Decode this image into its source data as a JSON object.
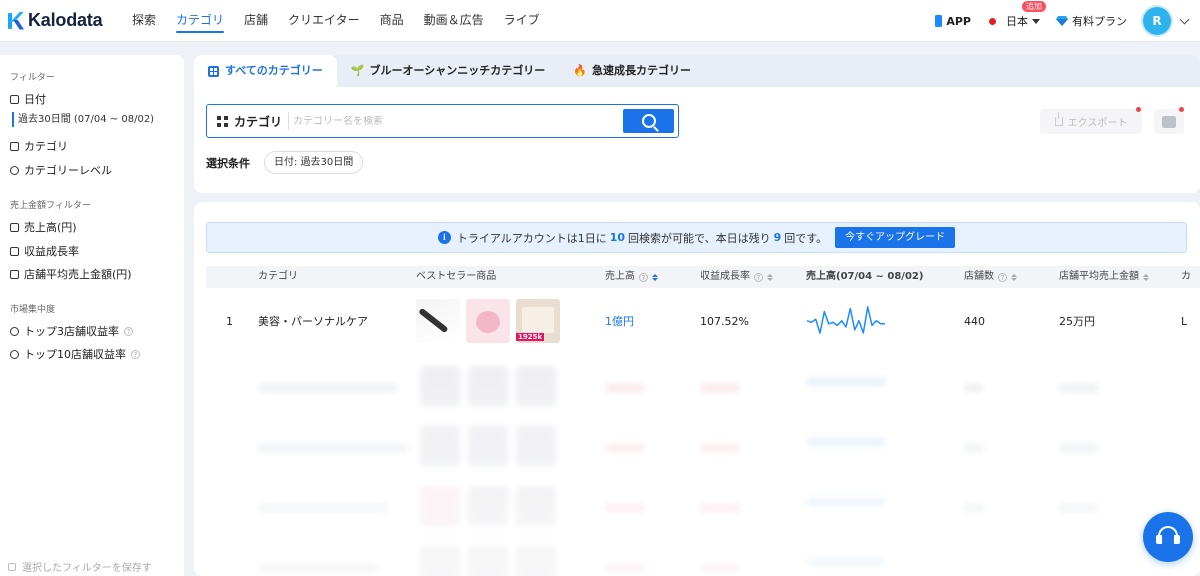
{
  "brand": {
    "name": "Kalodata"
  },
  "nav": {
    "items": [
      "探索",
      "カテゴリ",
      "店舗",
      "クリエイター",
      "商品",
      "動画＆広告",
      "ライブ"
    ],
    "active_index": 1,
    "app_label": "APP",
    "language": "日本",
    "plan_label": "有料プラン",
    "plan_badge": "追加",
    "avatar_initial": "R"
  },
  "sidebar": {
    "filter_title": "フィルター",
    "date_label": "日付",
    "date_value": "過去30日間 (07/04 ~ 08/02)",
    "category_label": "カテゴリ",
    "category_level_label": "カテゴリーレベル",
    "sales_filter_title": "売上金額フィルター",
    "sales_items": [
      "売上高(円)",
      "収益成長率",
      "店舗平均売上金額(円)"
    ],
    "concentration_title": "市場集中度",
    "concentration_items": [
      "トップ3店舗収益率",
      "トップ10店舗収益率"
    ],
    "save_filter_label": "選択したフィルターを保存す"
  },
  "tabs": {
    "items": [
      "すべてのカテゴリー",
      "ブルーオーシャンニッチカテゴリー",
      "急速成長カテゴリー"
    ],
    "active_index": 0
  },
  "search": {
    "label": "カテゴリ",
    "placeholder": "カテゴリー名を検索",
    "value": ""
  },
  "conditions": {
    "label": "選択条件",
    "chip": "日付: 過去30日間"
  },
  "export": {
    "label": "エクスポート"
  },
  "trial_banner": {
    "text_before": "トライアルアカウントは1日に",
    "daily_limit": "10",
    "text_middle": "回検索が可能で、本日は残り",
    "remaining": "9",
    "text_after": "回です。",
    "upgrade_label": "今すぐアップグレード"
  },
  "table": {
    "columns": [
      "カテゴリ",
      "ベストセラー商品",
      "売上高",
      "収益成長率",
      "売上高(07/04 ~ 08/02)",
      "店舗数",
      "店舗平均売上金額",
      "カ"
    ],
    "rows": [
      {
        "rank": "1",
        "category": "美容・パーソナルケア",
        "sales": "1億円",
        "growth": "107.52%",
        "shops": "440",
        "avg_sales": "25万円",
        "extra": "L",
        "product_badge": "1925k",
        "sparkline": [
          14,
          15,
          13,
          22,
          8,
          16,
          15,
          17,
          14,
          18,
          6,
          20,
          14,
          22,
          5,
          17,
          14,
          16,
          16
        ]
      }
    ]
  },
  "colors": {
    "primary": "#1a73e8",
    "background": "#eef1f6",
    "red_dot": "#e02020"
  }
}
